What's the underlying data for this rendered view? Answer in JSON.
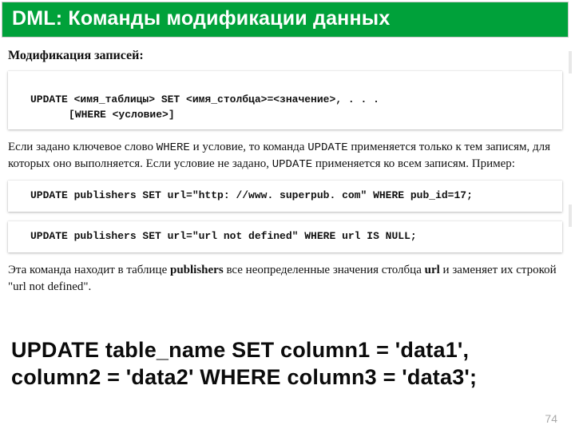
{
  "header": {
    "title": "DML: Команды модификации данных"
  },
  "section_title": "Модификация записей:",
  "syntax": {
    "line1": "UPDATE <имя_таблицы> SET <имя_столбца>=<значение>, . . .",
    "line2": "[WHERE <условие>]"
  },
  "para1_parts": {
    "t1": "Если задано ключевое слово ",
    "kw_where": "WHERE",
    "t2": " и условие, то команда ",
    "kw_update1": "UPDATE",
    "t3": " применяется только к тем записям, для которых оно выполняется. Если условие не задано, ",
    "kw_update2": "UPDATE",
    "t4": " применяется ко всем записям. Пример:"
  },
  "example1": "UPDATE publishers SET url=\"http: //www. superpub. com\" WHERE pub_id=17;",
  "example2": "UPDATE publishers SET url=\"url not defined\" WHERE url IS NULL;",
  "para2_parts": {
    "t1": "Эта команда находит в таблице ",
    "b1": "publishers",
    "t2": " все неопределенные значения столбца ",
    "b2": "url",
    "t3": " и заменяет их строкой \"url not defined\"."
  },
  "big_sql": "UPDATE table_name SET column1 = 'data1', column2 = 'data2' WHERE column3 = 'data3';",
  "page_number": "74"
}
